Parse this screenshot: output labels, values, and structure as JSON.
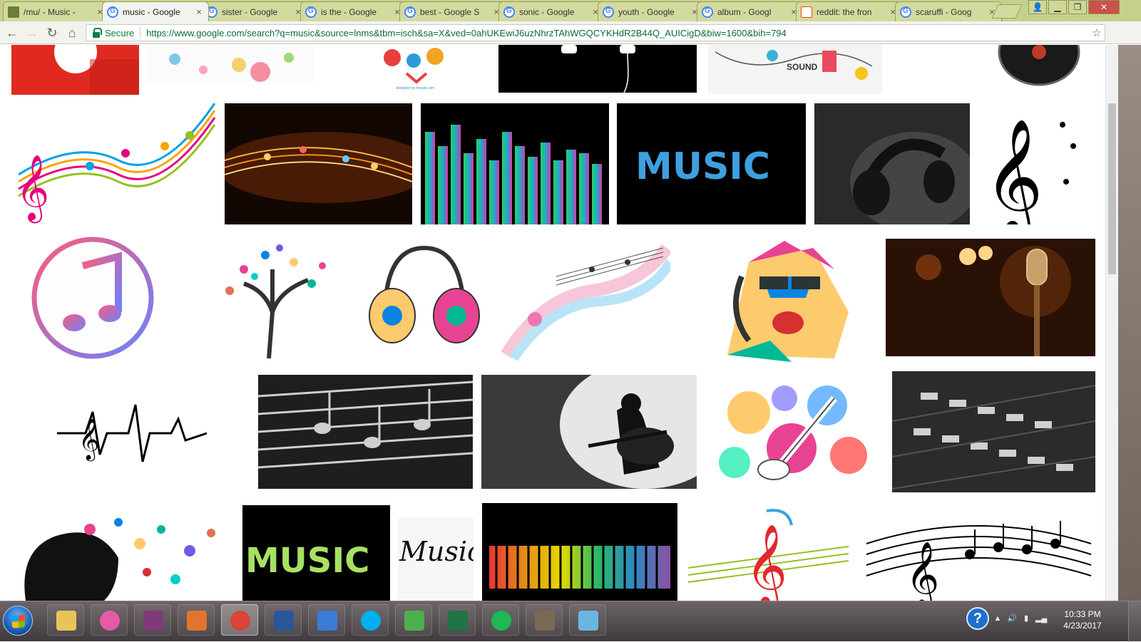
{
  "browser": {
    "tabs": [
      {
        "title": "/mu/ - Music -",
        "icon": "chan-icon",
        "active": false
      },
      {
        "title": "music - Google",
        "icon": "google-icon",
        "active": true
      },
      {
        "title": "sister - Google",
        "icon": "google-icon",
        "active": false
      },
      {
        "title": "is the - Google",
        "icon": "google-icon",
        "active": false
      },
      {
        "title": "best - Google S",
        "icon": "google-icon",
        "active": false
      },
      {
        "title": "sonic - Google",
        "icon": "google-icon",
        "active": false
      },
      {
        "title": "youth - Google",
        "icon": "google-icon",
        "active": false
      },
      {
        "title": "album - Googl",
        "icon": "google-icon",
        "active": false
      },
      {
        "title": "reddit: the fron",
        "icon": "reddit-icon",
        "active": false
      },
      {
        "title": "scaruffi - Goog",
        "icon": "google-icon",
        "active": false
      }
    ],
    "tab_close": "×",
    "secure_label": "Secure",
    "url": "https://www.google.com/search?q=music&source=lnms&tbm=isch&sa=X&ved=0ahUKEwiJ6uzNhrzTAhWGQCYKHdR2B44Q_AUICigD&biw=1600&bih=794",
    "colors": {
      "frame": "#c7d08a",
      "url_green": "#0b8043"
    }
  },
  "results": {
    "images": [
      {
        "desc": "red music app icon"
      },
      {
        "desc": "colorful music notes splash"
      },
      {
        "desc": "music icons heart illustration",
        "caption": "designed by freepik.com"
      },
      {
        "desc": "earphones on black"
      },
      {
        "desc": "sound doodle sketch",
        "caption": "SOUND"
      },
      {
        "desc": "vinyl record"
      },
      {
        "desc": "rainbow musical staff wave"
      },
      {
        "desc": "glowing orange music notes"
      },
      {
        "desc": "neon equalizer bars"
      },
      {
        "desc": "MUSIC paint text",
        "text": "MUSIC"
      },
      {
        "desc": "black and white headphones"
      },
      {
        "desc": "treble clef with notes"
      },
      {
        "desc": "iTunes icon"
      },
      {
        "desc": "music notes tree"
      },
      {
        "desc": "colorful headphones drawing"
      },
      {
        "desc": "rainbow note swirl"
      },
      {
        "desc": "pop art singer with headphones"
      },
      {
        "desc": "vintage microphone on stage"
      },
      {
        "desc": "heartbeat music line"
      },
      {
        "desc": "chalk music notes"
      },
      {
        "desc": "guitar player silhouette"
      },
      {
        "desc": "paint splash guitar"
      },
      {
        "desc": "mixing console"
      },
      {
        "desc": "head with colorful notes"
      },
      {
        "desc": "MUSIC grunge text",
        "text": "MUSIC"
      },
      {
        "desc": "music handwritten script",
        "text": "Music"
      },
      {
        "desc": "rainbow spectrum equalizer"
      },
      {
        "desc": "red clef on staff"
      },
      {
        "desc": "black staff with notes"
      }
    ]
  },
  "taskbar": {
    "apps": [
      {
        "name": "explorer",
        "color": "#e8c35a"
      },
      {
        "name": "itunes",
        "color": "#e85aa8"
      },
      {
        "name": "onenote",
        "color": "#80397b"
      },
      {
        "name": "office",
        "color": "#e3742f"
      },
      {
        "name": "chrome",
        "color": "#db4437"
      },
      {
        "name": "word",
        "color": "#2b579a"
      },
      {
        "name": "security",
        "color": "#3a7bd5"
      },
      {
        "name": "skype",
        "color": "#00aff0"
      },
      {
        "name": "maps",
        "color": "#4caf50"
      },
      {
        "name": "excel",
        "color": "#217346"
      },
      {
        "name": "spotify",
        "color": "#1db954"
      },
      {
        "name": "gimp",
        "color": "#7a6a55"
      },
      {
        "name": "paint",
        "color": "#6bb6e0"
      }
    ],
    "help_label": "?",
    "time": "10:33 PM",
    "date": "4/23/2017"
  }
}
